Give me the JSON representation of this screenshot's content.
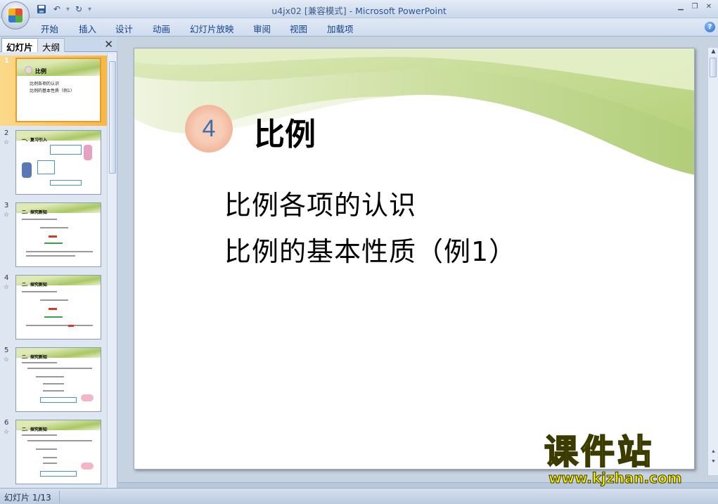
{
  "window": {
    "title_doc": "u4jx02 [兼容模式]",
    "title_sep": " - ",
    "title_app": "Microsoft PowerPoint",
    "controls": [
      "minimize-icon",
      "restore-icon",
      "close-icon"
    ]
  },
  "ribbon": {
    "tabs": [
      "开始",
      "插入",
      "设计",
      "动画",
      "幻灯片放映",
      "审阅",
      "视图",
      "加载项"
    ]
  },
  "pane": {
    "tab_slides": "幻灯片",
    "tab_outline": "大纲",
    "close": "✕"
  },
  "thumbnails": [
    {
      "num": "1",
      "title": "比例",
      "lines": [
        "比例各项的认识",
        "比例的基本性质（例1）"
      ]
    },
    {
      "num": "2",
      "title": "一、复习引入",
      "lines": []
    },
    {
      "num": "3",
      "title": "二、探究新知",
      "lines": []
    },
    {
      "num": "4",
      "title": "二、探究新知",
      "lines": []
    },
    {
      "num": "5",
      "title": "二、探究新知",
      "lines": []
    },
    {
      "num": "6",
      "title": "二、探究新知",
      "lines": []
    }
  ],
  "slide": {
    "badge": "4",
    "title": "比例",
    "line1": "比例各项的认识",
    "line2": "比例的基本性质（例1）"
  },
  "watermark": {
    "big": "课件站",
    "url": "www.kjzhan.com"
  },
  "status": {
    "slide_counter": "幻灯片 1/13"
  }
}
